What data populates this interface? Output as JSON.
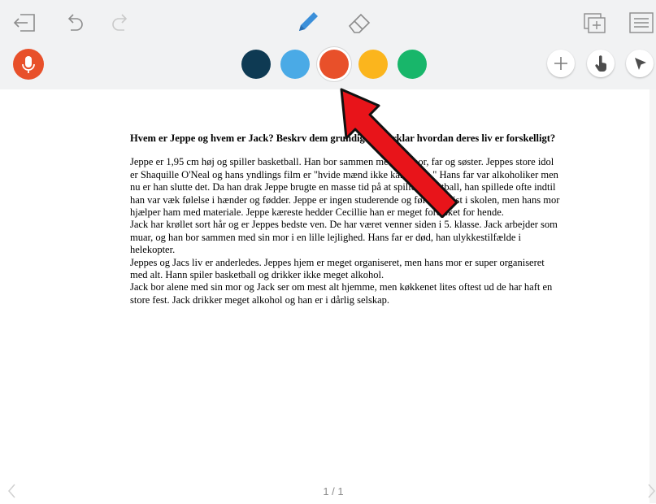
{
  "toolbar": {
    "icons": {
      "exit": "exit-icon",
      "undo": "undo-icon",
      "redo": "redo-icon",
      "pen": "pencil-icon",
      "eraser": "eraser-icon",
      "add_page": "add-page-icon",
      "pages": "pages-icon"
    },
    "pen_colors": [
      "#0e3a53",
      "#4aaae6",
      "#e8502a",
      "#fbb51d",
      "#18b66a"
    ],
    "selected_color": "#e8502a",
    "mic_color": "#e8502a",
    "tools": [
      "plus-icon",
      "hand-pointer-icon",
      "cursor-arrow-icon"
    ]
  },
  "document": {
    "heading": "Hvem er Jeppe og hvem er Jack? Beskrv dem grundigt og forklar hvordan deres liv er forskelligt?",
    "paragraphs": [
      "Jeppe er 1,95 cm høj og spiller basketball. Han bor sammen med sin mor, far og søster. Jeppes store idol er Shaquille O'Neal og hans yndlings film er \"hvide mænd ikke kan junke.\" Hans far var alkoholiker men nu er han slutte det. Da han drak Jeppe brugte en masse tid på at spille basketball, han spillede ofte indtil han var væk følelse i hænder og fødder. Jeppe er ingen studerende og føle sig trist i skolen, men hans mor hjælper ham med materiale. Jeppe kæreste hedder Cecillie han er meget forelsket for hende.",
      "Jack har krøllet sort hår og er Jeppes bedste ven. De har været venner siden i 5. klasse. Jack arbejder som muar, og han bor sammen med sin mor i en lille lejlighed. Hans far er død, han ulykkestilfælde i helekopter.",
      "Jeppes og Jacs liv er anderledes. Jeppes hjem er meget organiseret, men hans mor er super organiseret med alt. Hann spiler basketball og drikker ikke meget alkohol.",
      "Jack bor alene med sin mor og Jack ser om mest alt hjemme, men køkkenet lites oftest ud de har haft  en store fest. Jack drikker meget alkohol og han er i dårlig selskap."
    ]
  },
  "pagination": {
    "counter": "1 / 1"
  },
  "annotation": {
    "arrow_color": "#e8141a"
  }
}
